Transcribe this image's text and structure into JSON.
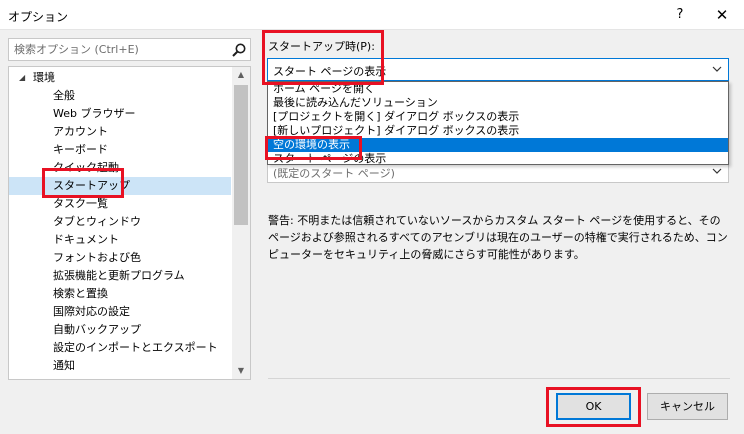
{
  "window": {
    "title": "オプション",
    "help_label": "?",
    "close_label": "✕"
  },
  "search": {
    "placeholder": "検索オプション (Ctrl+E)",
    "icon": "search-icon"
  },
  "tree": {
    "root_label": "環境",
    "items": [
      "全般",
      "Web ブラウザー",
      "アカウント",
      "キーボード",
      "クイック起動",
      "スタートアップ",
      "タスク一覧",
      "タブとウィンドウ",
      "ドキュメント",
      "フォントおよび色",
      "拡張機能と更新プログラム",
      "検索と置換",
      "国際対応の設定",
      "自動バックアップ",
      "設定のインポートとエクスポート",
      "通知"
    ],
    "selected": "スタートアップ"
  },
  "startup": {
    "label": "スタートアップ時(P):",
    "selected_value": "スタート ページの表示",
    "options": [
      "ホーム ページを開く",
      "最後に読み込んだソリューション",
      "[プロジェクトを開く] ダイアログ ボックスの表示",
      "[新しいプロジェクト] ダイアログ ボックスの表示",
      "空の環境の表示",
      "スタート ページの表示"
    ],
    "highlighted_option": "空の環境の表示",
    "secondary_value": "(既定のスタート ページ)"
  },
  "warning": "警告: 不明または信頼されていないソースからカスタム スタート ページを使用すると、そのページおよび参照されるすべてのアセンブリは現在のユーザーの特権で実行されるため、コンピューターをセキュリティ上の脅威にさらす可能性があります。",
  "buttons": {
    "ok": "OK",
    "cancel": "キャンセル"
  },
  "colors": {
    "accent": "#0078d7",
    "highlight_box": "#e81123"
  }
}
